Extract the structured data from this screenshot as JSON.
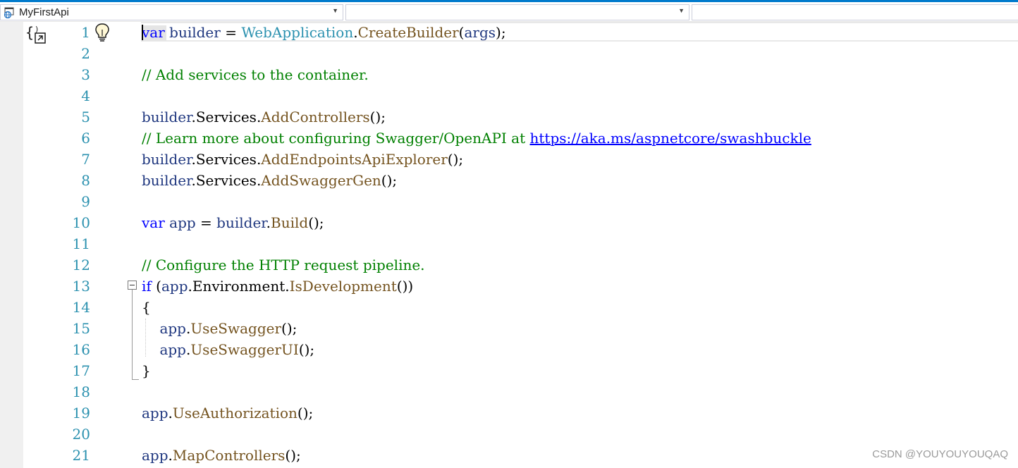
{
  "nav": {
    "project": "MyFirstApi",
    "member": "",
    "scope": ""
  },
  "colors": {
    "keyword": "#0000ff",
    "type": "#2b91af",
    "method": "#74531f",
    "identifier": "#1f377f",
    "comment": "#008000",
    "line_number": "#2b91af"
  },
  "icons": [
    "project-icon",
    "codelens-icon",
    "lightbulb-icon",
    "chevron-down-icon",
    "collapse-icon"
  ],
  "lines": [
    {
      "n": "1",
      "tokens": [
        [
          "kw",
          "var"
        ],
        [
          "",
          " "
        ],
        [
          "pl",
          "builder"
        ],
        [
          "",
          " = "
        ],
        [
          "tp",
          "WebApplication"
        ],
        [
          "",
          "."
        ],
        [
          "mt",
          "CreateBuilder"
        ],
        [
          "",
          "("
        ],
        [
          "pl",
          "args"
        ],
        [
          "",
          ");"
        ]
      ]
    },
    {
      "n": "2",
      "tokens": []
    },
    {
      "n": "3",
      "tokens": [
        [
          "cm",
          "// Add services to the container."
        ]
      ]
    },
    {
      "n": "4",
      "tokens": []
    },
    {
      "n": "5",
      "tokens": [
        [
          "pl",
          "builder"
        ],
        [
          "",
          "."
        ],
        [
          "",
          "Services"
        ],
        [
          "",
          "."
        ],
        [
          "mt",
          "AddControllers"
        ],
        [
          "",
          "();"
        ]
      ]
    },
    {
      "n": "6",
      "tokens": [
        [
          "cm",
          "// Learn more about configuring Swagger/OpenAPI at "
        ],
        [
          "lk",
          "https://aka.ms/aspnetcore/swashbuckle"
        ]
      ]
    },
    {
      "n": "7",
      "tokens": [
        [
          "pl",
          "builder"
        ],
        [
          "",
          "."
        ],
        [
          "",
          "Services"
        ],
        [
          "",
          "."
        ],
        [
          "mt",
          "AddEndpointsApiExplorer"
        ],
        [
          "",
          "();"
        ]
      ]
    },
    {
      "n": "8",
      "tokens": [
        [
          "pl",
          "builder"
        ],
        [
          "",
          "."
        ],
        [
          "",
          "Services"
        ],
        [
          "",
          "."
        ],
        [
          "mt",
          "AddSwaggerGen"
        ],
        [
          "",
          "();"
        ]
      ]
    },
    {
      "n": "9",
      "tokens": []
    },
    {
      "n": "10",
      "tokens": [
        [
          "kw",
          "var"
        ],
        [
          "",
          " "
        ],
        [
          "pl",
          "app"
        ],
        [
          "",
          " = "
        ],
        [
          "pl",
          "builder"
        ],
        [
          "",
          "."
        ],
        [
          "mt",
          "Build"
        ],
        [
          "",
          "();"
        ]
      ]
    },
    {
      "n": "11",
      "tokens": []
    },
    {
      "n": "12",
      "tokens": [
        [
          "cm",
          "// Configure the HTTP request pipeline."
        ]
      ]
    },
    {
      "n": "13",
      "tokens": [
        [
          "kw",
          "if"
        ],
        [
          "",
          " ("
        ],
        [
          "pl",
          "app"
        ],
        [
          "",
          "."
        ],
        [
          "",
          "Environment"
        ],
        [
          "",
          "."
        ],
        [
          "mt",
          "IsDevelopment"
        ],
        [
          "",
          "())"
        ]
      ]
    },
    {
      "n": "14",
      "tokens": [
        [
          "",
          "{"
        ]
      ]
    },
    {
      "n": "15",
      "tokens": [
        [
          "",
          "    "
        ],
        [
          "pl",
          "app"
        ],
        [
          "",
          "."
        ],
        [
          "mt",
          "UseSwagger"
        ],
        [
          "",
          "();"
        ]
      ]
    },
    {
      "n": "16",
      "tokens": [
        [
          "",
          "    "
        ],
        [
          "pl",
          "app"
        ],
        [
          "",
          "."
        ],
        [
          "mt",
          "UseSwaggerUI"
        ],
        [
          "",
          "();"
        ]
      ]
    },
    {
      "n": "17",
      "tokens": [
        [
          "",
          "}"
        ]
      ]
    },
    {
      "n": "18",
      "tokens": []
    },
    {
      "n": "19",
      "tokens": [
        [
          "pl",
          "app"
        ],
        [
          "",
          "."
        ],
        [
          "mt",
          "UseAuthorization"
        ],
        [
          "",
          "();"
        ]
      ]
    },
    {
      "n": "20",
      "tokens": []
    },
    {
      "n": "21",
      "tokens": [
        [
          "pl",
          "app"
        ],
        [
          "",
          "."
        ],
        [
          "mt",
          "MapControllers"
        ],
        [
          "",
          "();"
        ]
      ]
    }
  ],
  "watermark": "CSDN @YOUYOUYOUQAQ"
}
